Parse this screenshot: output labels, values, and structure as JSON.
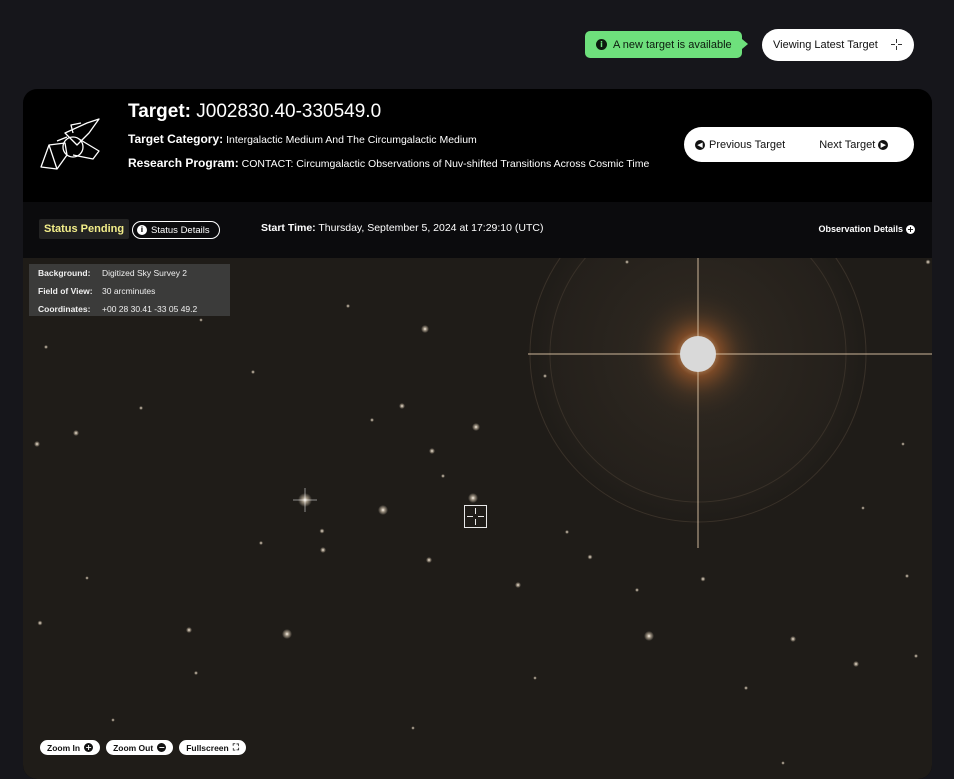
{
  "notification": {
    "text": "A new target is available",
    "icon": "info-icon",
    "color": "#6ee07c"
  },
  "viewing_button": {
    "label": "Viewing Latest Target",
    "icon": "crosshair-icon"
  },
  "target": {
    "title_label": "Target:",
    "name": "J002830.40-330549.0",
    "category_label": "Target Category:",
    "category": "Intergalactic Medium And The Circumgalactic Medium",
    "program_label": "Research Program:",
    "program": "CONTACT: Circumgalactic Observations of Nuv-shifted Transitions Across Cosmic Time"
  },
  "nav": {
    "previous_label": "Previous Target",
    "next_label": "Next Target"
  },
  "status": {
    "badge": "Status Pending",
    "badge_color": "#f3ee8a",
    "details_label": "Status Details",
    "start_label": "Start Time:",
    "start_value": "Thursday, September 5, 2024 at 17:29:10 (UTC)",
    "observation_details_label": "Observation Details"
  },
  "viewer": {
    "background_label": "Background:",
    "background_value": "Digitized Sky Survey 2",
    "fov_label": "Field of View:",
    "fov_value": "30 arcminutes",
    "coords_label": "Coordinates:",
    "coords_value": "+00 28 30.41 -33 05 49.2",
    "zoom_in_label": "Zoom In",
    "zoom_out_label": "Zoom Out",
    "fullscreen_label": "Fullscreen"
  }
}
